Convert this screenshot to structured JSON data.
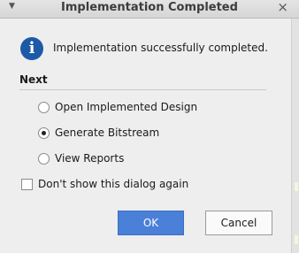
{
  "window": {
    "title": "Implementation Completed",
    "menu_icon": "window-menu-icon",
    "close_icon": "close-icon"
  },
  "message": {
    "icon": "info-icon",
    "text": "Implementation successfully completed."
  },
  "next": {
    "label": "Next",
    "options": [
      {
        "label": "Open Implemented Design",
        "selected": false
      },
      {
        "label": "Generate Bitstream",
        "selected": true
      },
      {
        "label": "View Reports",
        "selected": false
      }
    ]
  },
  "dont_show": {
    "label": "Don't show this dialog again",
    "checked": false
  },
  "buttons": {
    "ok": "OK",
    "cancel": "Cancel"
  },
  "colors": {
    "accent": "#4a80d8",
    "info_icon": "#1c5aa8"
  }
}
